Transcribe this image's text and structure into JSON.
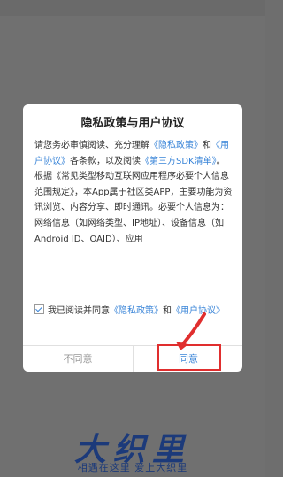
{
  "dialog": {
    "title": "隐私政策与用户协议",
    "intro_1": "请您务必审慎阅读、充分理解",
    "privacy_link": "《隐私政策》",
    "intro_and": "和",
    "user_agreement_link": "《用户协议》",
    "intro_2": "各条款，以及阅读",
    "sdk_link": "《第三方SDK清单》",
    "intro_end": "。",
    "body_text": "根据《常见类型移动互联网应用程序必要个人信息范围规定》，本App属于社区类APP，主要功能为资讯浏览、内容分享、即时通讯。必要个人信息为：网络信息（如网络类型、IP地址）、设备信息（如Android ID、OAID）、应用"
  },
  "agree_row": {
    "prefix": "我已阅读并同意",
    "privacy_link": "《隐私政策》",
    "and": "和",
    "user_agreement_link": "《用户协议》"
  },
  "buttons": {
    "disagree": "不同意",
    "agree": "同意"
  },
  "brand": {
    "logo": "大织里",
    "slogan": "相遇在这里 爱上大织里"
  },
  "colors": {
    "link": "#3a85d8",
    "highlight": "#e02e2e",
    "brand": "#1c3a7a"
  }
}
